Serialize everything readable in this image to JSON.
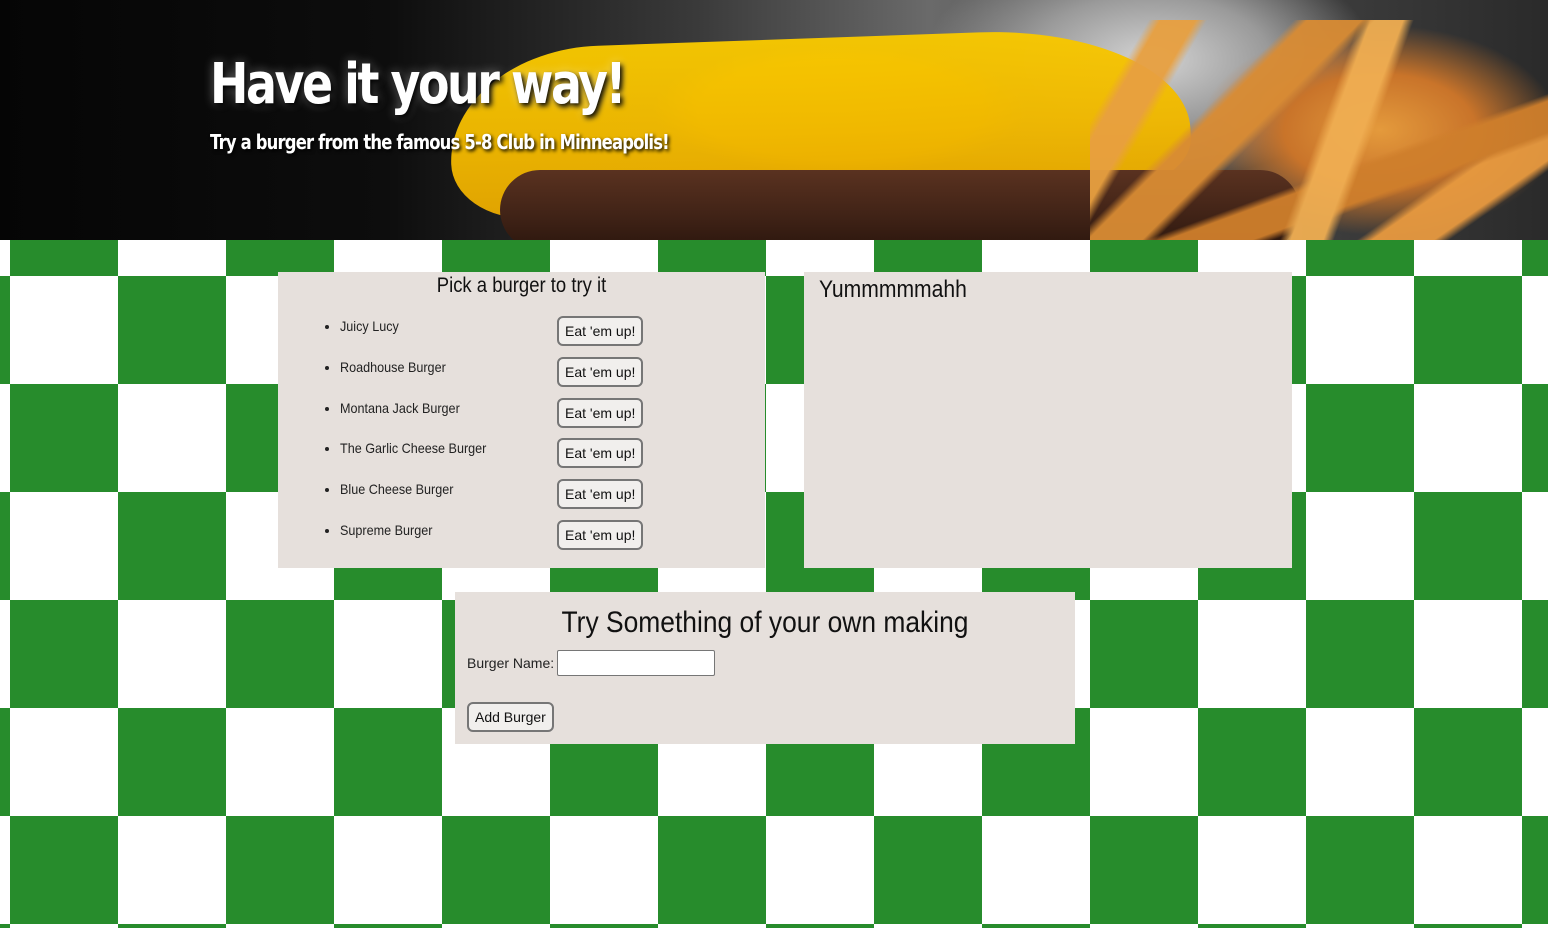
{
  "hero": {
    "title": "Have it your way!",
    "subtitle": "Try a burger from the famous 5-8 Club in Minneapolis!"
  },
  "menu": {
    "title": "Pick a burger to try it",
    "button_label": "Eat 'em up!",
    "burgers": [
      {
        "name": "Juicy Lucy",
        "button": "Eat 'em up!"
      },
      {
        "name": "Roadhouse Burger",
        "button": "Eat 'em up!"
      },
      {
        "name": "Montana Jack Burger",
        "button": "Eat 'em up!"
      },
      {
        "name": "The Garlic Cheese Burger",
        "button": "Eat 'em up!"
      },
      {
        "name": "Blue Cheese Burger",
        "button": "Eat 'em up!"
      },
      {
        "name": "Supreme Burger",
        "button": "Eat 'em up!"
      }
    ]
  },
  "eaten": {
    "title": "Yummmmmahh"
  },
  "add_form": {
    "title": "Try Something of your own making",
    "label": "Burger Name:",
    "input_value": "",
    "submit_label": "Add Burger"
  },
  "colors": {
    "checker_green": "#278c2c",
    "panel_bg": "#e6e0dc"
  }
}
